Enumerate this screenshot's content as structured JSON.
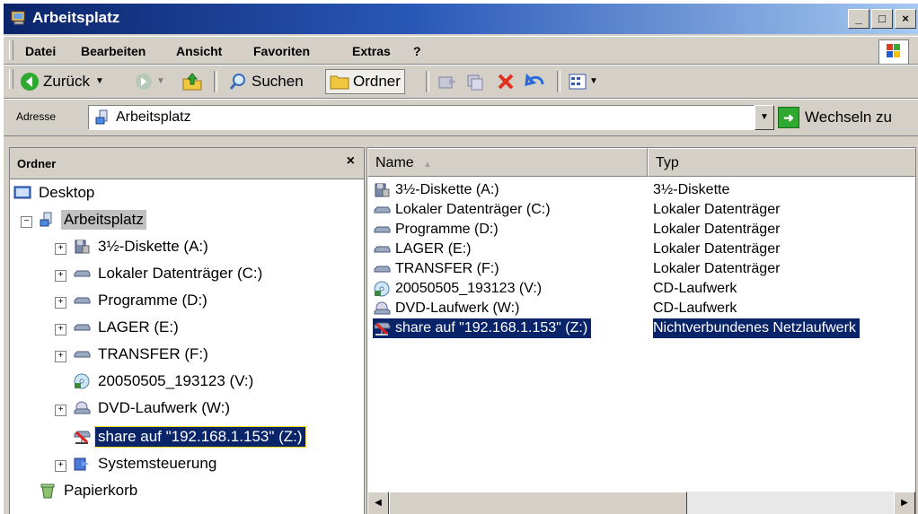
{
  "window": {
    "title": "Arbeitsplatz",
    "buttons": [
      "_",
      "□",
      "×"
    ]
  },
  "menu": [
    "Datei",
    "Bearbeiten",
    "Ansicht",
    "Favoriten",
    "Extras",
    "?"
  ],
  "toolbar": {
    "back": "Zurück",
    "search": "Suchen",
    "folders": "Ordner"
  },
  "address": {
    "label": "Adresse",
    "value": "Arbeitsplatz",
    "go": "Wechseln zu"
  },
  "folders_pane": {
    "title": "Ordner",
    "close": "×",
    "tree": [
      {
        "label": "Desktop",
        "icon": "desktop-icon"
      },
      {
        "label": "Arbeitsplatz",
        "icon": "computer-icon"
      },
      {
        "label": "3½-Diskette (A:)",
        "icon": "floppy-icon"
      },
      {
        "label": "Lokaler Datenträger (C:)",
        "icon": "hard-drive-icon"
      },
      {
        "label": "Programme (D:)",
        "icon": "hard-drive-icon"
      },
      {
        "label": "LAGER (E:)",
        "icon": "hard-drive-icon"
      },
      {
        "label": "TRANSFER (F:)",
        "icon": "hard-drive-icon"
      },
      {
        "label": "20050505_193123 (V:)",
        "icon": "cd-icon"
      },
      {
        "label": "DVD-Laufwerk (W:)",
        "icon": "dvd-icon"
      },
      {
        "label": "share auf \"192.168.1.153\" (Z:)",
        "icon": "network-drive-icon"
      },
      {
        "label": "Systemsteuerung",
        "icon": "control-panel-icon"
      },
      {
        "label": "Papierkorb",
        "icon": "recycle-bin-icon"
      }
    ]
  },
  "list": {
    "columns": [
      "Name",
      "Typ"
    ],
    "rows": [
      {
        "name": "3½-Diskette (A:)",
        "type": "3½-Diskette",
        "icon": "floppy-icon"
      },
      {
        "name": "Lokaler Datenträger (C:)",
        "type": "Lokaler Datenträger",
        "icon": "hard-drive-icon"
      },
      {
        "name": "Programme (D:)",
        "type": "Lokaler Datenträger",
        "icon": "hard-drive-icon"
      },
      {
        "name": "LAGER (E:)",
        "type": "Lokaler Datenträger",
        "icon": "hard-drive-icon"
      },
      {
        "name": "TRANSFER (F:)",
        "type": "Lokaler Datenträger",
        "icon": "hard-drive-icon"
      },
      {
        "name": "20050505_193123 (V:)",
        "type": "CD-Laufwerk",
        "icon": "cd-icon"
      },
      {
        "name": "DVD-Laufwerk (W:)",
        "type": "CD-Laufwerk",
        "icon": "dvd-icon"
      },
      {
        "name": "share auf \"192.168.1.153\" (Z:)",
        "type": "Nichtverbundenes Netzlaufwerk",
        "icon": "network-drive-icon"
      }
    ]
  }
}
